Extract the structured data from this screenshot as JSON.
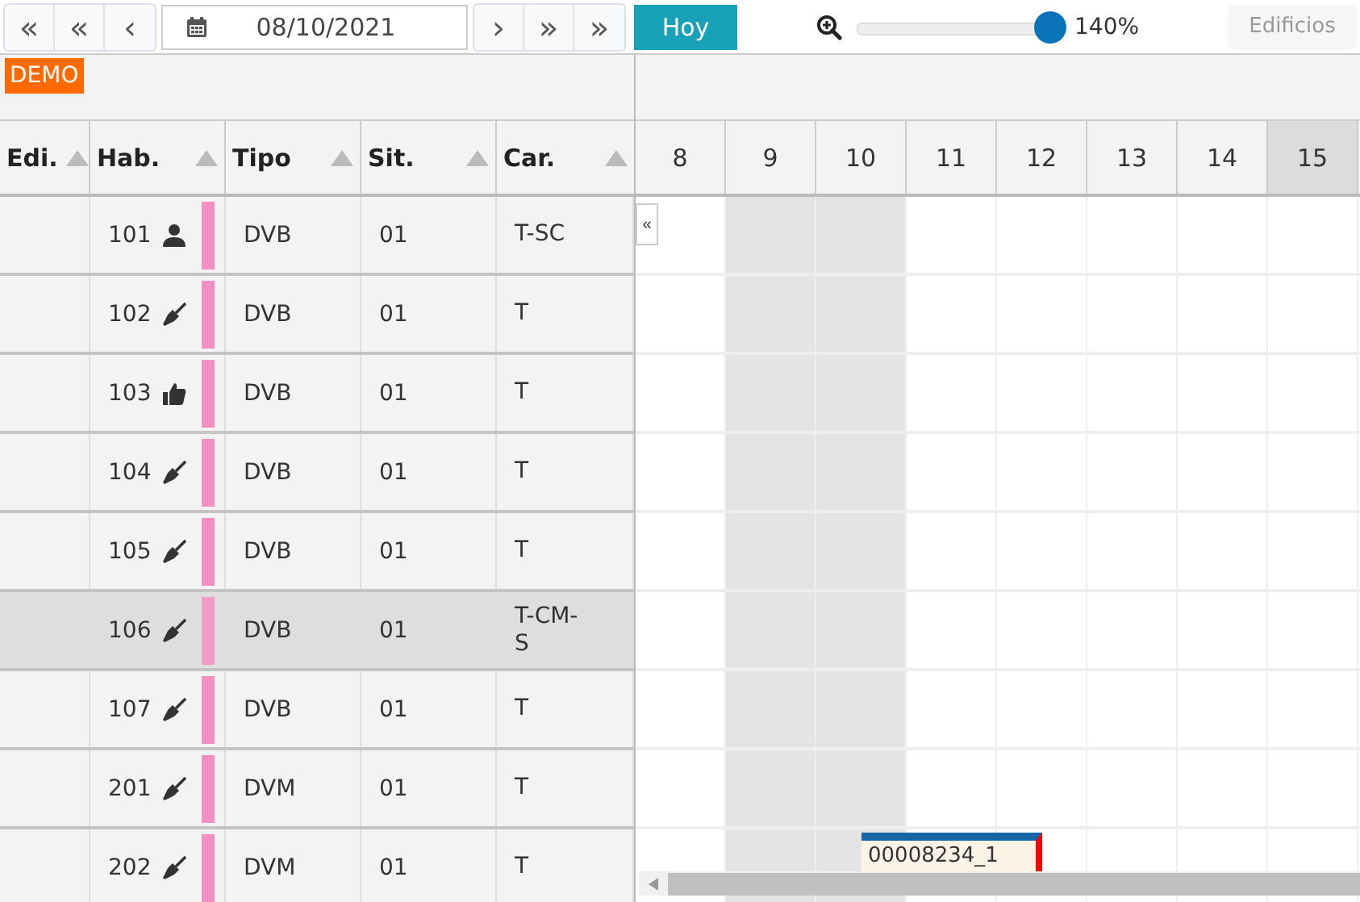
{
  "toolbar": {
    "nav_prev": [
      "«",
      "«",
      "‹"
    ],
    "date": "08/10/2021",
    "nav_next": [
      "›",
      "»",
      "»"
    ],
    "today_button": "Hoy",
    "zoom": {
      "level": 0.95,
      "reading": "140%"
    },
    "buildings_button": "Edificios"
  },
  "demo_badge": "DEMO",
  "columns": [
    {
      "label": "Edi."
    },
    {
      "label": "Hab."
    },
    {
      "label": "Tipo"
    },
    {
      "label": "Sit."
    },
    {
      "label": "Car."
    }
  ],
  "days": [
    {
      "label": "8",
      "shaded": false,
      "today": false
    },
    {
      "label": "9",
      "shaded": true,
      "today": false
    },
    {
      "label": "10",
      "shaded": true,
      "today": false
    },
    {
      "label": "11",
      "shaded": false,
      "today": false
    },
    {
      "label": "12",
      "shaded": false,
      "today": false
    },
    {
      "label": "13",
      "shaded": false,
      "today": false
    },
    {
      "label": "14",
      "shaded": false,
      "today": false
    },
    {
      "label": "15",
      "shaded": false,
      "today": true
    }
  ],
  "collapse_button": "«",
  "rows": [
    {
      "room": "101",
      "kind": "occupied",
      "color": "#f48fc4",
      "type": "DVB",
      "sit": "01",
      "car": "T-SC",
      "selected": false
    },
    {
      "room": "102",
      "kind": "dirty",
      "color": "#f48fc4",
      "type": "DVB",
      "sit": "01",
      "car": "T",
      "selected": false
    },
    {
      "room": "103",
      "kind": "ok",
      "color": "#f48fc4",
      "type": "DVB",
      "sit": "01",
      "car": "T",
      "selected": false
    },
    {
      "room": "104",
      "kind": "dirty",
      "color": "#f48fc4",
      "type": "DVB",
      "sit": "01",
      "car": "T",
      "selected": false
    },
    {
      "room": "105",
      "kind": "dirty",
      "color": "#f48fc4",
      "type": "DVB",
      "sit": "01",
      "car": "T",
      "selected": false
    },
    {
      "room": "106",
      "kind": "dirty",
      "color": "#f48fc4",
      "type": "DVB",
      "sit": "01",
      "car": "T-CM-S",
      "selected": true
    },
    {
      "room": "107",
      "kind": "dirty",
      "color": "#f48fc4",
      "type": "DVB",
      "sit": "01",
      "car": "T",
      "selected": false
    },
    {
      "room": "201",
      "kind": "dirty",
      "color": "#f48fc4",
      "type": "DVM",
      "sit": "01",
      "car": "T",
      "selected": false
    },
    {
      "room": "202",
      "kind": "dirty",
      "color": "#f48fc4",
      "type": "DVM",
      "sit": "01",
      "car": "T",
      "selected": false,
      "booking": {
        "label": "00008234_1"
      }
    }
  ]
}
